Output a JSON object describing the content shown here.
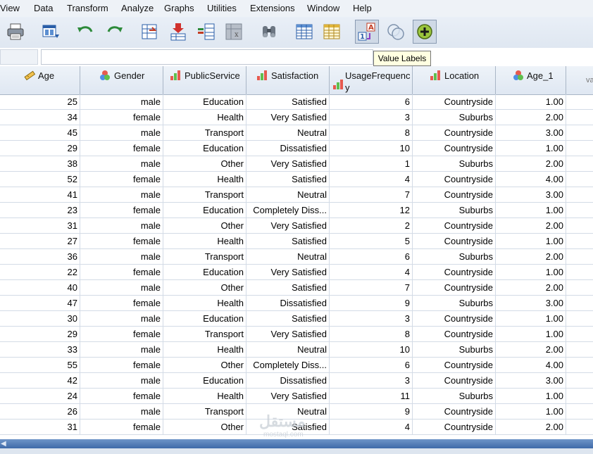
{
  "menu": [
    "View",
    "Data",
    "Transform",
    "Analyze",
    "Graphs",
    "Utilities",
    "Extensions",
    "Window",
    "Help"
  ],
  "tooltip": "Value Labels",
  "columns": [
    {
      "name": "Age",
      "icon": "ruler-scale-icon"
    },
    {
      "name": "Gender",
      "icon": "nominal-circles-icon"
    },
    {
      "name": "PublicService",
      "icon": "ordinal-bars-icon"
    },
    {
      "name": "Satisfaction",
      "icon": "ordinal-bars-icon"
    },
    {
      "name": "UsageFrequency",
      "icon": "ordinal-bars-icon"
    },
    {
      "name": "Location",
      "icon": "ordinal-bars-icon"
    },
    {
      "name": "Age_1",
      "icon": "nominal-circles-icon"
    },
    {
      "name": "va",
      "icon": ""
    }
  ],
  "rows": [
    [
      "25",
      "male",
      "Education",
      "Satisfied",
      "6",
      "Countryside",
      "1.00"
    ],
    [
      "34",
      "female",
      "Health",
      "Very Satisfied",
      "3",
      "Suburbs",
      "2.00"
    ],
    [
      "45",
      "male",
      "Transport",
      "Neutral",
      "8",
      "Countryside",
      "3.00"
    ],
    [
      "29",
      "female",
      "Education",
      "Dissatisfied",
      "10",
      "Countryside",
      "1.00"
    ],
    [
      "38",
      "male",
      "Other",
      "Very Satisfied",
      "1",
      "Suburbs",
      "2.00"
    ],
    [
      "52",
      "female",
      "Health",
      "Satisfied",
      "4",
      "Countryside",
      "4.00"
    ],
    [
      "41",
      "male",
      "Transport",
      "Neutral",
      "7",
      "Countryside",
      "3.00"
    ],
    [
      "23",
      "female",
      "Education",
      "Completely Diss...",
      "12",
      "Suburbs",
      "1.00"
    ],
    [
      "31",
      "male",
      "Other",
      "Very Satisfied",
      "2",
      "Countryside",
      "2.00"
    ],
    [
      "27",
      "female",
      "Health",
      "Satisfied",
      "5",
      "Countryside",
      "1.00"
    ],
    [
      "36",
      "male",
      "Transport",
      "Neutral",
      "6",
      "Suburbs",
      "2.00"
    ],
    [
      "22",
      "female",
      "Education",
      "Very Satisfied",
      "4",
      "Countryside",
      "1.00"
    ],
    [
      "40",
      "male",
      "Other",
      "Satisfied",
      "7",
      "Countryside",
      "2.00"
    ],
    [
      "47",
      "female",
      "Health",
      "Dissatisfied",
      "9",
      "Suburbs",
      "3.00"
    ],
    [
      "30",
      "male",
      "Education",
      "Satisfied",
      "3",
      "Countryside",
      "1.00"
    ],
    [
      "29",
      "female",
      "Transport",
      "Very Satisfied",
      "8",
      "Countryside",
      "1.00"
    ],
    [
      "33",
      "male",
      "Health",
      "Neutral",
      "10",
      "Suburbs",
      "2.00"
    ],
    [
      "55",
      "female",
      "Other",
      "Completely Diss...",
      "6",
      "Countryside",
      "4.00"
    ],
    [
      "42",
      "male",
      "Education",
      "Dissatisfied",
      "3",
      "Countryside",
      "3.00"
    ],
    [
      "24",
      "female",
      "Health",
      "Very Satisfied",
      "11",
      "Suburbs",
      "1.00"
    ],
    [
      "26",
      "male",
      "Transport",
      "Neutral",
      "9",
      "Countryside",
      "1.00"
    ],
    [
      "31",
      "female",
      "Other",
      "Satisfied",
      "4",
      "Countryside",
      "2.00"
    ]
  ],
  "watermark": {
    "text": "مستقل",
    "sub": "mostaql.com"
  }
}
